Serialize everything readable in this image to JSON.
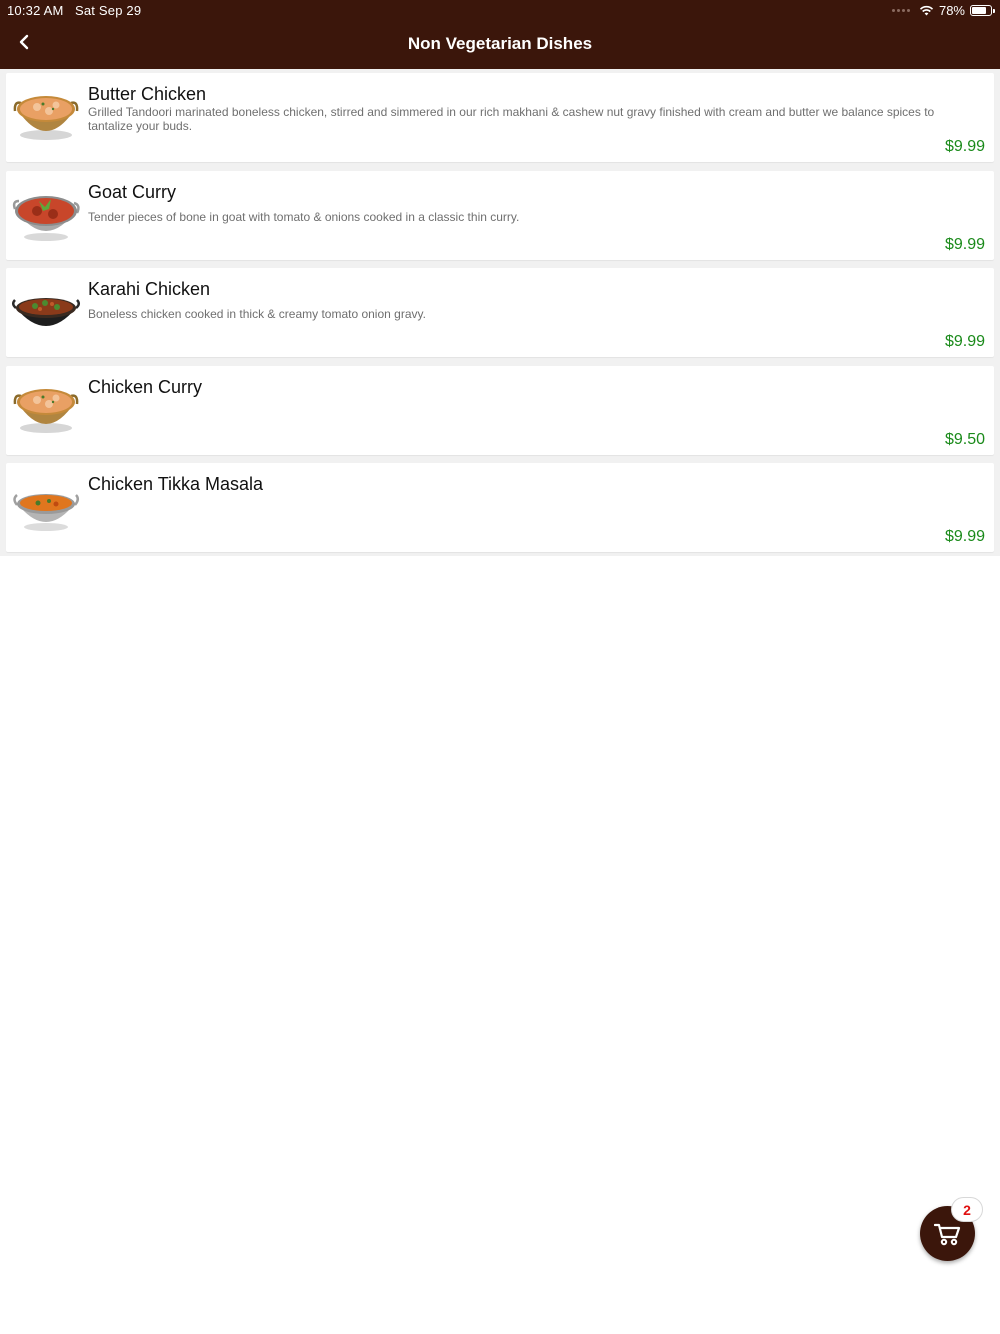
{
  "status_bar": {
    "time": "10:32 AM",
    "date": "Sat Sep 29",
    "battery": "78%",
    "battery_level": 0.78,
    "wifi_icon": "wifi-icon"
  },
  "nav": {
    "title": "Non Vegetarian Dishes",
    "back_icon": "chevron-left-icon"
  },
  "dishes": [
    {
      "name": "Butter Chicken",
      "description": "Grilled Tandoori marinated boneless chicken, stirred and simmered in our rich makhani & cashew nut gravy finished with cream and butter we balance spices to tantalize your buds.",
      "price": "$9.99",
      "image": "butter-chicken-bowl"
    },
    {
      "name": "Goat Curry",
      "description": "Tender pieces of bone in goat with tomato & onions cooked in a classic thin curry.",
      "price": "$9.99",
      "image": "goat-curry-bowl"
    },
    {
      "name": "Karahi Chicken",
      "description": "Boneless chicken cooked in thick & creamy tomato onion gravy.",
      "price": "$9.99",
      "image": "karahi-chicken-bowl"
    },
    {
      "name": "Chicken Curry",
      "description": "",
      "price": "$9.50",
      "image": "chicken-curry-bowl"
    },
    {
      "name": "Chicken Tikka Masala",
      "description": "",
      "price": "$9.99",
      "image": "chicken-tikka-masala-bowl"
    }
  ],
  "cart": {
    "count": "2",
    "icon": "cart-icon"
  },
  "colors": {
    "header": "#3b160b",
    "price": "#1a8a1a",
    "badge_text": "#e01010"
  }
}
